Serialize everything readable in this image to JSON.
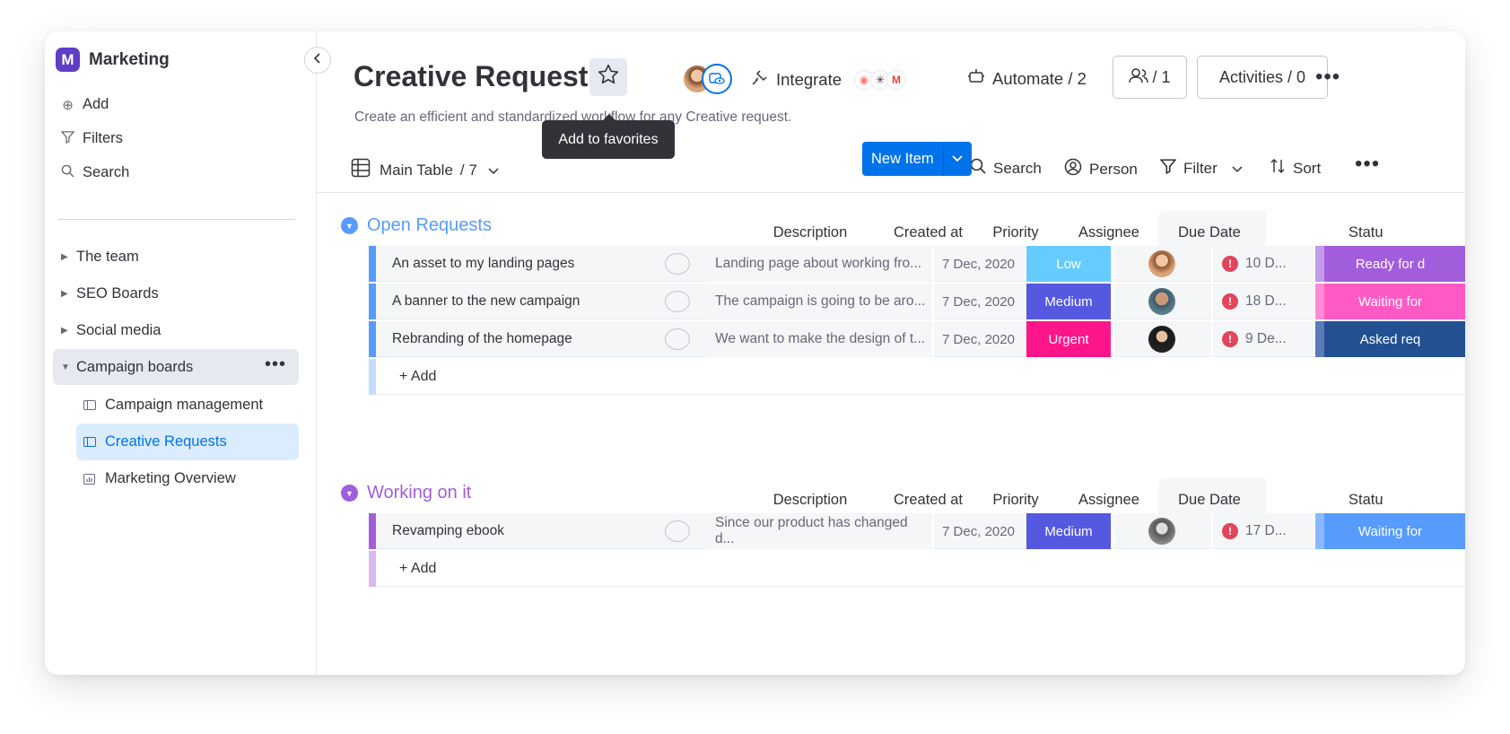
{
  "workspace": {
    "name": "Marketing",
    "logo_letter": "M",
    "color": "#5f3dc4"
  },
  "sidebar": {
    "actions": [
      {
        "label": "Add",
        "icon": "plus-circle-icon"
      },
      {
        "label": "Filters",
        "icon": "filter-icon"
      },
      {
        "label": "Search",
        "icon": "search-icon"
      }
    ],
    "folders": [
      {
        "label": "The team"
      },
      {
        "label": "SEO Boards"
      },
      {
        "label": "Social media"
      },
      {
        "label": "Campaign boards",
        "expanded": true
      }
    ],
    "boards": [
      {
        "label": "Campaign management",
        "icon": "board-icon"
      },
      {
        "label": "Creative Requests",
        "icon": "board-icon",
        "active": true
      },
      {
        "label": "Marketing Overview",
        "icon": "dashboard-icon"
      }
    ]
  },
  "header": {
    "title": "Creative Requests",
    "subtitle": "Create an efficient and standardized workflow for any Creative request.",
    "tooltip": "Add to favorites",
    "integrate": "Integrate",
    "automate": "Automate / 2",
    "members": "/ 1",
    "activities": "Activities / 0"
  },
  "toolbar": {
    "view": "Main Table",
    "view_count": "/ 7",
    "new_item": "New Item",
    "search": "Search",
    "person": "Person",
    "filter": "Filter",
    "sort": "Sort"
  },
  "columns": {
    "description": "Description",
    "created": "Created at",
    "priority": "Priority",
    "assignee": "Assignee",
    "due": "Due Date",
    "status": "Statu"
  },
  "colors": {
    "accent": "#0073ea",
    "low": "#579bfc",
    "medium": "#5559df",
    "urgent": "#ff158a",
    "group1": "#579bfc",
    "group2": "#a25ddc"
  },
  "groups": [
    {
      "title": "Open Requests",
      "add_label": "+ Add",
      "items": [
        {
          "name": "An asset to my landing pages",
          "description": "Landing page about working fro...",
          "created": "7 Dec, 2020",
          "priority": "Low",
          "due": "10 D...",
          "status": "Ready for d"
        },
        {
          "name": "A banner to the new campaign",
          "description": "The campaign is going to be aro...",
          "created": "7 Dec, 2020",
          "priority": "Medium",
          "due": "18 D...",
          "status": "Waiting for"
        },
        {
          "name": "Rebranding of the homepage",
          "description": "We want to make the design of t...",
          "created": "7 Dec, 2020",
          "priority": "Urgent",
          "due": "9 De...",
          "status": "Asked req"
        }
      ]
    },
    {
      "title": "Working on it",
      "add_label": "+ Add",
      "items": [
        {
          "name": "Revamping ebook",
          "description": "Since our product has changed d...",
          "created": "7 Dec, 2020",
          "priority": "Medium",
          "due": "17 D...",
          "status": "Waiting for"
        }
      ]
    }
  ]
}
